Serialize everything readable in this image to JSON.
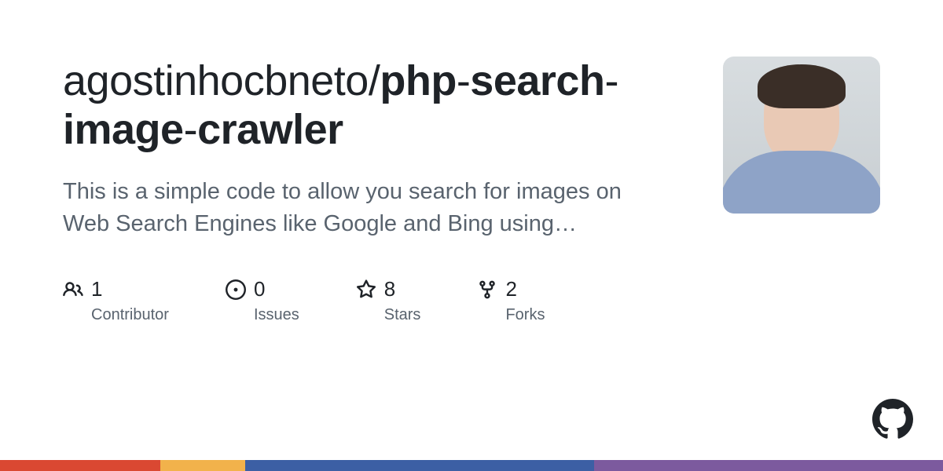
{
  "repo": {
    "owner": "agostinhocbneto",
    "name_parts": [
      "php",
      "search",
      "image",
      "crawler"
    ]
  },
  "description": "This is a simple code to allow you search for images on Web Search Engines like Google and Bing using…",
  "stats": {
    "contributors": {
      "count": "1",
      "label": "Contributor"
    },
    "issues": {
      "count": "0",
      "label": "Issues"
    },
    "stars": {
      "count": "8",
      "label": "Stars"
    },
    "forks": {
      "count": "2",
      "label": "Forks"
    }
  },
  "footer_colors": [
    {
      "color": "#da4832",
      "width": "17%"
    },
    {
      "color": "#f2b24b",
      "width": "9%"
    },
    {
      "color": "#3c5fa4",
      "width": "37%"
    },
    {
      "color": "#7c5a9e",
      "width": "37%"
    }
  ]
}
